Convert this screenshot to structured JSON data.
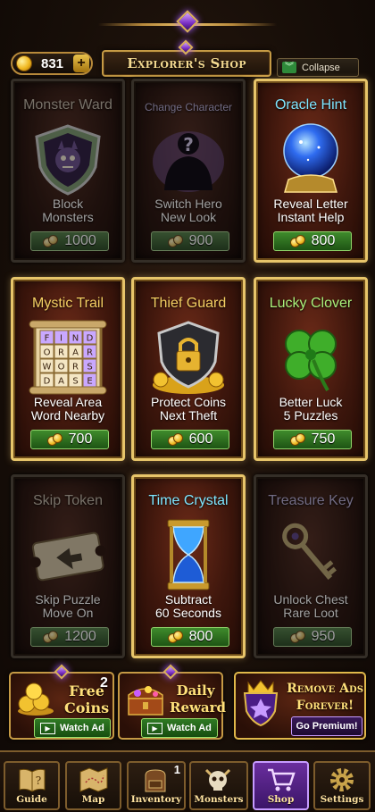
{
  "header": {
    "title": "Explorer's Shop",
    "coins": "831",
    "add_label": "+",
    "collapse_label": "Collapse"
  },
  "items": [
    {
      "name": "Monster Ward",
      "desc1": "Block",
      "desc2": "Monsters",
      "price": "1000",
      "state": "locked"
    },
    {
      "name": "Change Character",
      "desc1": "Switch Hero",
      "desc2": "New Look",
      "price": "900",
      "state": "locked"
    },
    {
      "name": "Oracle Hint",
      "desc1": "Reveal Letter",
      "desc2": "Instant Help",
      "price": "800",
      "state": "active"
    },
    {
      "name": "Mystic Trail",
      "desc1": "Reveal Area",
      "desc2": "Word Nearby",
      "price": "700",
      "state": "active",
      "grid_letters": [
        "F",
        "I",
        "N",
        "D",
        "O",
        "R",
        "A",
        "R",
        "W",
        "O",
        "R",
        "S",
        "D",
        "A",
        "S",
        "E"
      ]
    },
    {
      "name": "Thief Guard",
      "desc1": "Protect Coins",
      "desc2": "Next Theft",
      "price": "600",
      "state": "active"
    },
    {
      "name": "Lucky Clover",
      "desc1": "Better Luck",
      "desc2": "5 Puzzles",
      "price": "750",
      "state": "active"
    },
    {
      "name": "Skip Token",
      "desc1": "Skip Puzzle",
      "desc2": "Move On",
      "price": "1200",
      "state": "locked"
    },
    {
      "name": "Time Crystal",
      "desc1": "Subtract",
      "desc2": "60 Seconds",
      "price": "800",
      "state": "active"
    },
    {
      "name": "Treasure Key",
      "desc1": "Unlock Chest",
      "desc2": "Rare Loot",
      "price": "950",
      "state": "locked"
    }
  ],
  "promos": {
    "free_coins": {
      "line1": "Free",
      "line2": "Coins",
      "badge": "2",
      "button": "Watch Ad"
    },
    "daily_reward": {
      "line1": "Daily",
      "line2": "Reward",
      "button": "Watch Ad"
    },
    "remove_ads": {
      "line1": "Remove Ads",
      "line2": "Forever!",
      "button": "Go Premium!"
    }
  },
  "nav": [
    {
      "label": "Guide",
      "icon": "book-icon"
    },
    {
      "label": "Map",
      "icon": "map-icon"
    },
    {
      "label": "Inventory",
      "icon": "backpack-icon",
      "badge": "1"
    },
    {
      "label": "Monsters",
      "icon": "skull-icon"
    },
    {
      "label": "Shop",
      "icon": "cart-icon",
      "active": true
    },
    {
      "label": "Settings",
      "icon": "gear-icon"
    }
  ],
  "colors": {
    "gold": "#f4cf63",
    "price_green": "#3f8b2c",
    "active_nav": "#6a2e9e",
    "frame": "#9b7a42"
  }
}
